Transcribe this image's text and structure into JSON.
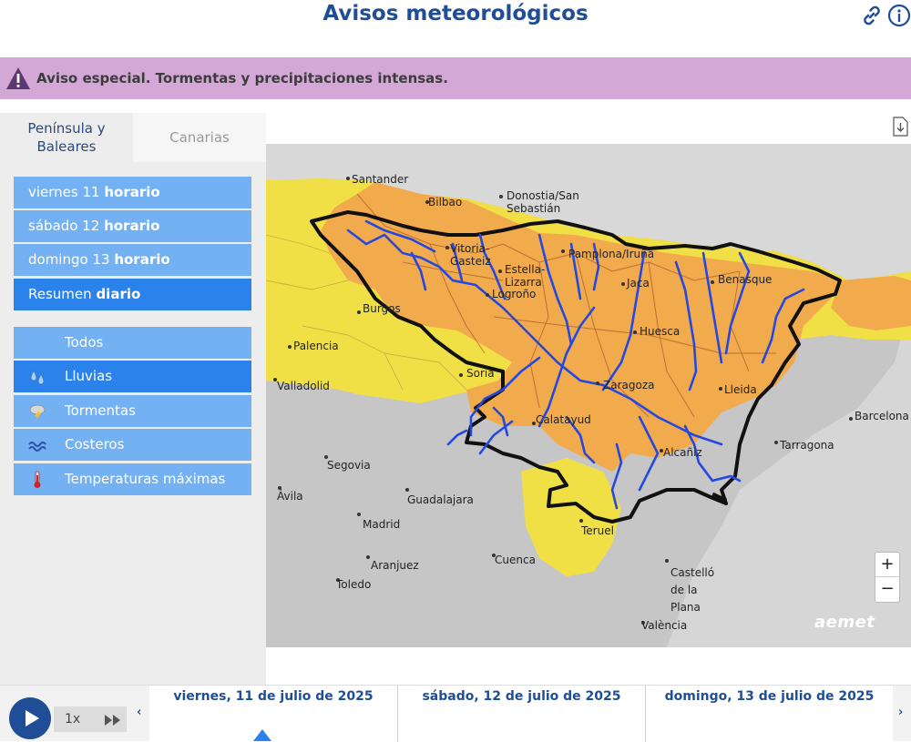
{
  "header": {
    "title": "Avisos meteorológicos"
  },
  "banner": {
    "text": "Aviso especial. Tormentas y precipitaciones intensas."
  },
  "tabs": [
    {
      "label": "Península y Baleares",
      "active": true
    },
    {
      "label": "Canarias",
      "active": false
    }
  ],
  "days": [
    {
      "day": "viernes 11",
      "mode": "horario"
    },
    {
      "day": "sábado 12",
      "mode": "horario"
    },
    {
      "day": "domingo 13",
      "mode": "horario"
    },
    {
      "day": "Resumen",
      "mode": "diario",
      "selected": true
    }
  ],
  "filters": [
    {
      "label": "Todos",
      "icon": "none"
    },
    {
      "label": "Lluvias",
      "icon": "rain-icon",
      "selected": true
    },
    {
      "label": "Tormentas",
      "icon": "storm-icon"
    },
    {
      "label": "Costeros",
      "icon": "waves-icon"
    },
    {
      "label": "Temperaturas máximas",
      "icon": "thermometer-icon"
    }
  ],
  "map": {
    "cities": [
      "Santander",
      "Bilbao",
      "Donostia/San Sebastián",
      "Vitoria-Gasteiz",
      "Pamplona/Iruña",
      "Estella-Lizarra",
      "Logroño",
      "Burgos",
      "Jaca",
      "Benasque",
      "Huesca",
      "Palencia",
      "Soria",
      "Zaragoza",
      "Valladolid",
      "Lleida",
      "Barcelona",
      "Calatayud",
      "Tarragona",
      "Alcañiz",
      "Segovia",
      "Ávila",
      "Guadalajara",
      "Madrid",
      "Teruel",
      "Cuenca",
      "Aranjuez",
      "Toledo",
      "Castelló de la Plana",
      "València"
    ],
    "zoom_in": "+",
    "zoom_out": "−",
    "logo": "aemet",
    "colors": {
      "yellow": "#f0e045",
      "orange": "#f1ab4c",
      "gray": "#c9c9c9",
      "border": "#111111",
      "rivers": "#2549e0"
    }
  },
  "timeline": {
    "speed": "1x",
    "dates": [
      "viernes, 11 de julio de 2025",
      "sábado, 12 de julio de 2025",
      "domingo, 13 de julio de 2025"
    ]
  }
}
